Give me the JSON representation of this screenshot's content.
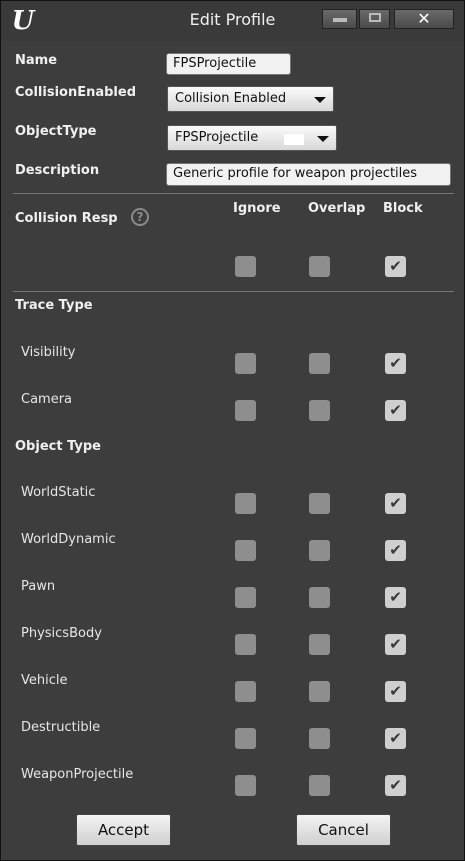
{
  "window": {
    "title": "Edit Profile",
    "close_glyph": "✕"
  },
  "fields": {
    "name_label": "Name",
    "name_value": "FPSProjectile",
    "collision_enabled_label": "CollisionEnabled",
    "collision_enabled_value": "Collision Enabled",
    "object_type_label": "ObjectType",
    "object_type_value": "FPSProjectile",
    "description_label": "Description",
    "description_value": "Generic profile for weapon projectiles"
  },
  "collision": {
    "label": "Collision Resp",
    "help_glyph": "?",
    "columns": [
      "Ignore",
      "Overlap",
      "Block"
    ],
    "all": {
      "ignore": false,
      "overlap": false,
      "block": true
    }
  },
  "trace_type": {
    "heading": "Trace Type",
    "rows": [
      {
        "label": "Visibility",
        "ignore": false,
        "overlap": false,
        "block": true
      },
      {
        "label": "Camera",
        "ignore": false,
        "overlap": false,
        "block": true
      }
    ]
  },
  "object_type": {
    "heading": "Object Type",
    "rows": [
      {
        "label": "WorldStatic",
        "ignore": false,
        "overlap": false,
        "block": true
      },
      {
        "label": "WorldDynamic",
        "ignore": false,
        "overlap": false,
        "block": true
      },
      {
        "label": "Pawn",
        "ignore": false,
        "overlap": false,
        "block": true
      },
      {
        "label": "PhysicsBody",
        "ignore": false,
        "overlap": false,
        "block": true
      },
      {
        "label": "Vehicle",
        "ignore": false,
        "overlap": false,
        "block": true
      },
      {
        "label": "Destructible",
        "ignore": false,
        "overlap": false,
        "block": true
      },
      {
        "label": "WeaponProjectile",
        "ignore": false,
        "overlap": false,
        "block": true
      }
    ]
  },
  "buttons": {
    "accept": "Accept",
    "cancel": "Cancel"
  },
  "check_glyph": "✔",
  "icons": {
    "logo": "unreal-logo-icon",
    "help": "help-icon",
    "check": "checkmark-icon"
  }
}
